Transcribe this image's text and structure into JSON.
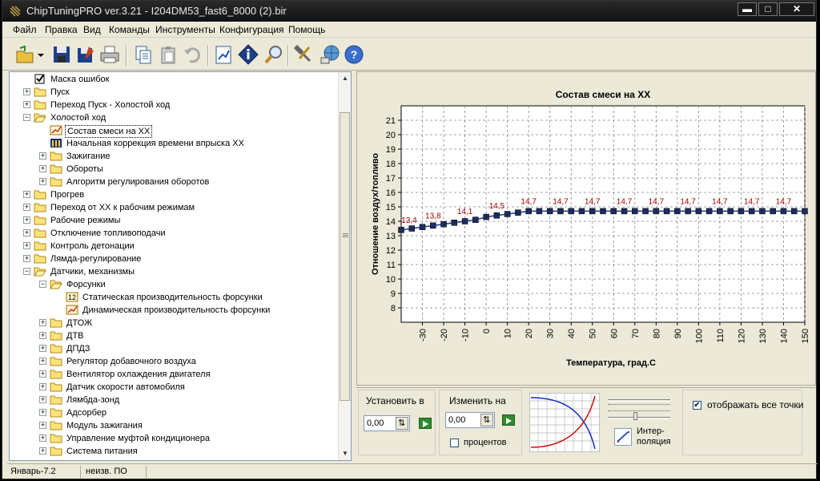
{
  "window": {
    "title": "ChipTuningPRO ver.3.21 - I204DM53_fast6_8000 (2).bir",
    "min_label": "▬",
    "max_label": "□",
    "close_label": "✕"
  },
  "menu": [
    "Файл",
    "Правка",
    "Вид",
    "Команды",
    "Инструменты",
    "Конфигурация",
    "Помощь"
  ],
  "toolbar_icons": [
    "open-icon",
    "dropdown-arrow-icon",
    "save-icon",
    "save-as-icon",
    "print-icon",
    "copy-icon",
    "paste-icon",
    "undo-icon",
    "map-editor-icon",
    "info-icon",
    "search-icon",
    "tools-icon",
    "network-icon",
    "help-icon"
  ],
  "tree": [
    {
      "level": 1,
      "label": "Маска ошибок",
      "icon": "checkbox",
      "expander": "none"
    },
    {
      "level": 1,
      "label": "Пуск",
      "icon": "folder",
      "expander": "plus"
    },
    {
      "level": 1,
      "label": "Переход Пуск - Холостой ход",
      "icon": "folder",
      "expander": "plus"
    },
    {
      "level": 1,
      "label": "Холостой ход",
      "icon": "folder-open",
      "expander": "minus"
    },
    {
      "level": 2,
      "label": "Состав смеси на ХХ",
      "icon": "graph",
      "expander": "none",
      "selected": true
    },
    {
      "level": 2,
      "label": "Начальная коррекция времени впрыска ХХ",
      "icon": "table",
      "expander": "none"
    },
    {
      "level": 2,
      "label": "Зажигание",
      "icon": "folder",
      "expander": "plus"
    },
    {
      "level": 2,
      "label": "Обороты",
      "icon": "folder",
      "expander": "plus"
    },
    {
      "level": 2,
      "label": "Алгоритм регулирования оборотов",
      "icon": "folder",
      "expander": "plus"
    },
    {
      "level": 1,
      "label": "Прогрев",
      "icon": "folder",
      "expander": "plus"
    },
    {
      "level": 1,
      "label": "Переход от ХХ к рабочим режимам",
      "icon": "folder",
      "expander": "plus"
    },
    {
      "level": 1,
      "label": "Рабочие режимы",
      "icon": "folder",
      "expander": "plus"
    },
    {
      "level": 1,
      "label": "Отключение топливоподачи",
      "icon": "folder",
      "expander": "plus"
    },
    {
      "level": 1,
      "label": "Контроль детонации",
      "icon": "folder",
      "expander": "plus"
    },
    {
      "level": 1,
      "label": "Лямда-регулирование",
      "icon": "folder",
      "expander": "plus"
    },
    {
      "level": 1,
      "label": "Датчики, механизмы",
      "icon": "folder-open",
      "expander": "minus"
    },
    {
      "level": 2,
      "label": "Форсунки",
      "icon": "folder-open",
      "expander": "minus"
    },
    {
      "level": 3,
      "label": "Статическая производительность форсунки",
      "icon": "constant",
      "expander": "none"
    },
    {
      "level": 3,
      "label": "Динамическая производительность форсунки",
      "icon": "graph",
      "expander": "none"
    },
    {
      "level": 2,
      "label": "ДТОЖ",
      "icon": "folder",
      "expander": "plus"
    },
    {
      "level": 2,
      "label": "ДТВ",
      "icon": "folder",
      "expander": "plus"
    },
    {
      "level": 2,
      "label": "ДПДЗ",
      "icon": "folder",
      "expander": "plus"
    },
    {
      "level": 2,
      "label": "Регулятор добавочного воздуха",
      "icon": "folder",
      "expander": "plus"
    },
    {
      "level": 2,
      "label": "Вентилятор охлаждения двигателя",
      "icon": "folder",
      "expander": "plus"
    },
    {
      "level": 2,
      "label": "Датчик скорости автомобиля",
      "icon": "folder",
      "expander": "plus"
    },
    {
      "level": 2,
      "label": "Лямбда-зонд",
      "icon": "folder",
      "expander": "plus"
    },
    {
      "level": 2,
      "label": "Адсорбер",
      "icon": "folder",
      "expander": "plus"
    },
    {
      "level": 2,
      "label": "Модуль зажигания",
      "icon": "folder",
      "expander": "plus"
    },
    {
      "level": 2,
      "label": "Управление муфтой кондиционера",
      "icon": "folder",
      "expander": "plus"
    },
    {
      "level": 2,
      "label": "Система питания",
      "icon": "folder",
      "expander": "plus"
    }
  ],
  "tree_constant_badge": "12",
  "controls": {
    "set_label": "Установить в",
    "set_value": "0,00",
    "change_label": "Изменить на",
    "change_value": "0,00",
    "percent_label": "процентов",
    "interp_label_1": "Интер-",
    "interp_label_2": "поляция",
    "show_all_label": "отображать все точки",
    "show_all_checked": "✔",
    "spin_glyph": "⇅"
  },
  "status": {
    "cell1": "Январь-7.2",
    "cell2": "неизв. ПО"
  },
  "chart_data": {
    "type": "line",
    "title": "Состав смеси на ХХ",
    "xlabel": "Температура, град.С",
    "ylabel": "Отношение воздух/топливо",
    "xlim": [
      -40,
      150
    ],
    "ylim": [
      7,
      22
    ],
    "xticks": [
      -30,
      -20,
      -10,
      0,
      10,
      20,
      30,
      40,
      50,
      60,
      70,
      80,
      90,
      100,
      110,
      120,
      130,
      140,
      150
    ],
    "yticks": [
      8,
      9,
      10,
      11,
      12,
      13,
      14,
      15,
      16,
      17,
      18,
      19,
      20,
      21
    ],
    "grid": true,
    "line_color": "#1f3a8a",
    "marker_color": "#1b2d5c",
    "label_color": "#a00000",
    "x": [
      -40,
      -35,
      -30,
      -25,
      -20,
      -15,
      -10,
      -5,
      0,
      5,
      10,
      15,
      20,
      25,
      30,
      35,
      40,
      45,
      50,
      55,
      60,
      65,
      70,
      75,
      80,
      85,
      90,
      95,
      100,
      105,
      110,
      115,
      120,
      125,
      130,
      135,
      140,
      145,
      150
    ],
    "y": [
      13.4,
      13.5,
      13.6,
      13.7,
      13.8,
      13.9,
      14.0,
      14.1,
      14.3,
      14.4,
      14.5,
      14.6,
      14.7,
      14.7,
      14.7,
      14.7,
      14.7,
      14.7,
      14.7,
      14.7,
      14.7,
      14.7,
      14.7,
      14.7,
      14.7,
      14.7,
      14.7,
      14.7,
      14.7,
      14.7,
      14.7,
      14.7,
      14.7,
      14.7,
      14.7,
      14.7,
      14.7,
      14.7,
      14.7
    ],
    "point_labels": [
      {
        "x": -40,
        "text": "13,4"
      },
      {
        "x": -25,
        "text": "13,8"
      },
      {
        "x": -10,
        "text": "14,1"
      },
      {
        "x": 5,
        "text": "14,5"
      },
      {
        "x": 20,
        "text": "14,7"
      },
      {
        "x": 35,
        "text": "14,7"
      },
      {
        "x": 50,
        "text": "14,7"
      },
      {
        "x": 65,
        "text": "14,7"
      },
      {
        "x": 80,
        "text": "14,7"
      },
      {
        "x": 95,
        "text": "14,7"
      },
      {
        "x": 110,
        "text": "14,7"
      },
      {
        "x": 125,
        "text": "14,7"
      },
      {
        "x": 140,
        "text": "14,7"
      }
    ]
  }
}
